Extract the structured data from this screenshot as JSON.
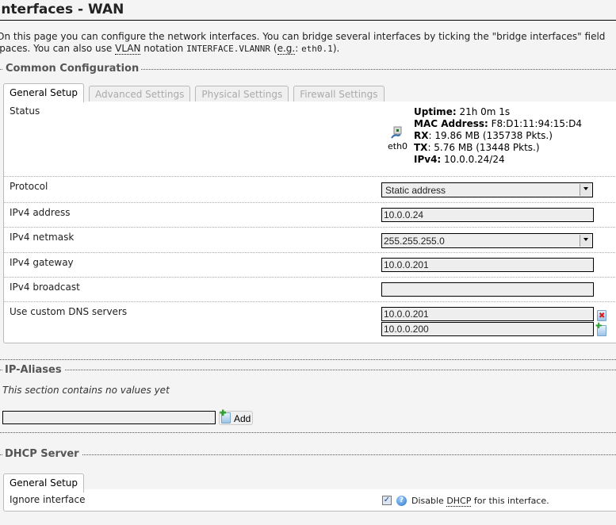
{
  "page": {
    "title": "Interfaces - WAN",
    "description_line1": "On this page you can configure the network interfaces. You can bridge several interfaces by ticking the \"bridge interfaces\" field",
    "description_line2_prefix": "spaces. You can also use ",
    "description_vlan_abbr": "VLAN",
    "description_line2_mid": " notation ",
    "description_notation": "INTERFACE.VLANNR",
    "description_eg_open": " (",
    "description_eg_abbr": "e.g.",
    "description_eg_sep": ": ",
    "description_example": "eth0.1",
    "description_close": ")."
  },
  "common": {
    "legend": "Common Configuration",
    "tabs": [
      {
        "label": "General Setup",
        "active": true
      },
      {
        "label": "Advanced Settings",
        "active": false
      },
      {
        "label": "Physical Settings",
        "active": false
      },
      {
        "label": "Firewall Settings",
        "active": false
      }
    ],
    "status": {
      "label": "Status",
      "device_name": "eth0",
      "uptime_label": "Uptime:",
      "uptime_value": " 21h 0m 1s",
      "mac_label": "MAC Address:",
      "mac_value": " F8:D1:11:94:15:D4",
      "rx_label": "RX",
      "rx_value": ": 19.86 MB (135738 Pkts.)",
      "tx_label": "TX",
      "tx_value": ": 5.76 MB (13448 Pkts.)",
      "ipv4_label": "IPv4:",
      "ipv4_value": " 10.0.0.24/24"
    },
    "protocol": {
      "label": "Protocol",
      "value": "Static address"
    },
    "ipv4_address": {
      "label": "IPv4 address",
      "value": "10.0.0.24"
    },
    "ipv4_netmask": {
      "label": "IPv4 netmask",
      "value": "255.255.255.0"
    },
    "ipv4_gateway": {
      "label": "IPv4 gateway",
      "value": "10.0.0.201"
    },
    "ipv4_broadcast": {
      "label": "IPv4 broadcast",
      "value": ""
    },
    "dns": {
      "label": "Use custom DNS servers",
      "servers": [
        "10.0.0.201",
        "10.0.0.200"
      ]
    }
  },
  "ip_aliases": {
    "legend": "IP-Aliases",
    "empty_note": "This section contains no values yet",
    "new_name_value": "",
    "add_label": "Add"
  },
  "dhcp": {
    "legend": "DHCP Server",
    "tabs": [
      {
        "label": "General Setup",
        "active": true
      }
    ],
    "ignore": {
      "label": "Ignore interface",
      "checked": true,
      "desc_prefix": "Disable ",
      "desc_abbr": "DHCP",
      "desc_suffix": " for this interface."
    }
  },
  "colors": {
    "page_bg": "#f4f4f4",
    "panel_bg": "#ffffff",
    "legend_text": "#555555",
    "input_bg": "#eeeeee"
  }
}
